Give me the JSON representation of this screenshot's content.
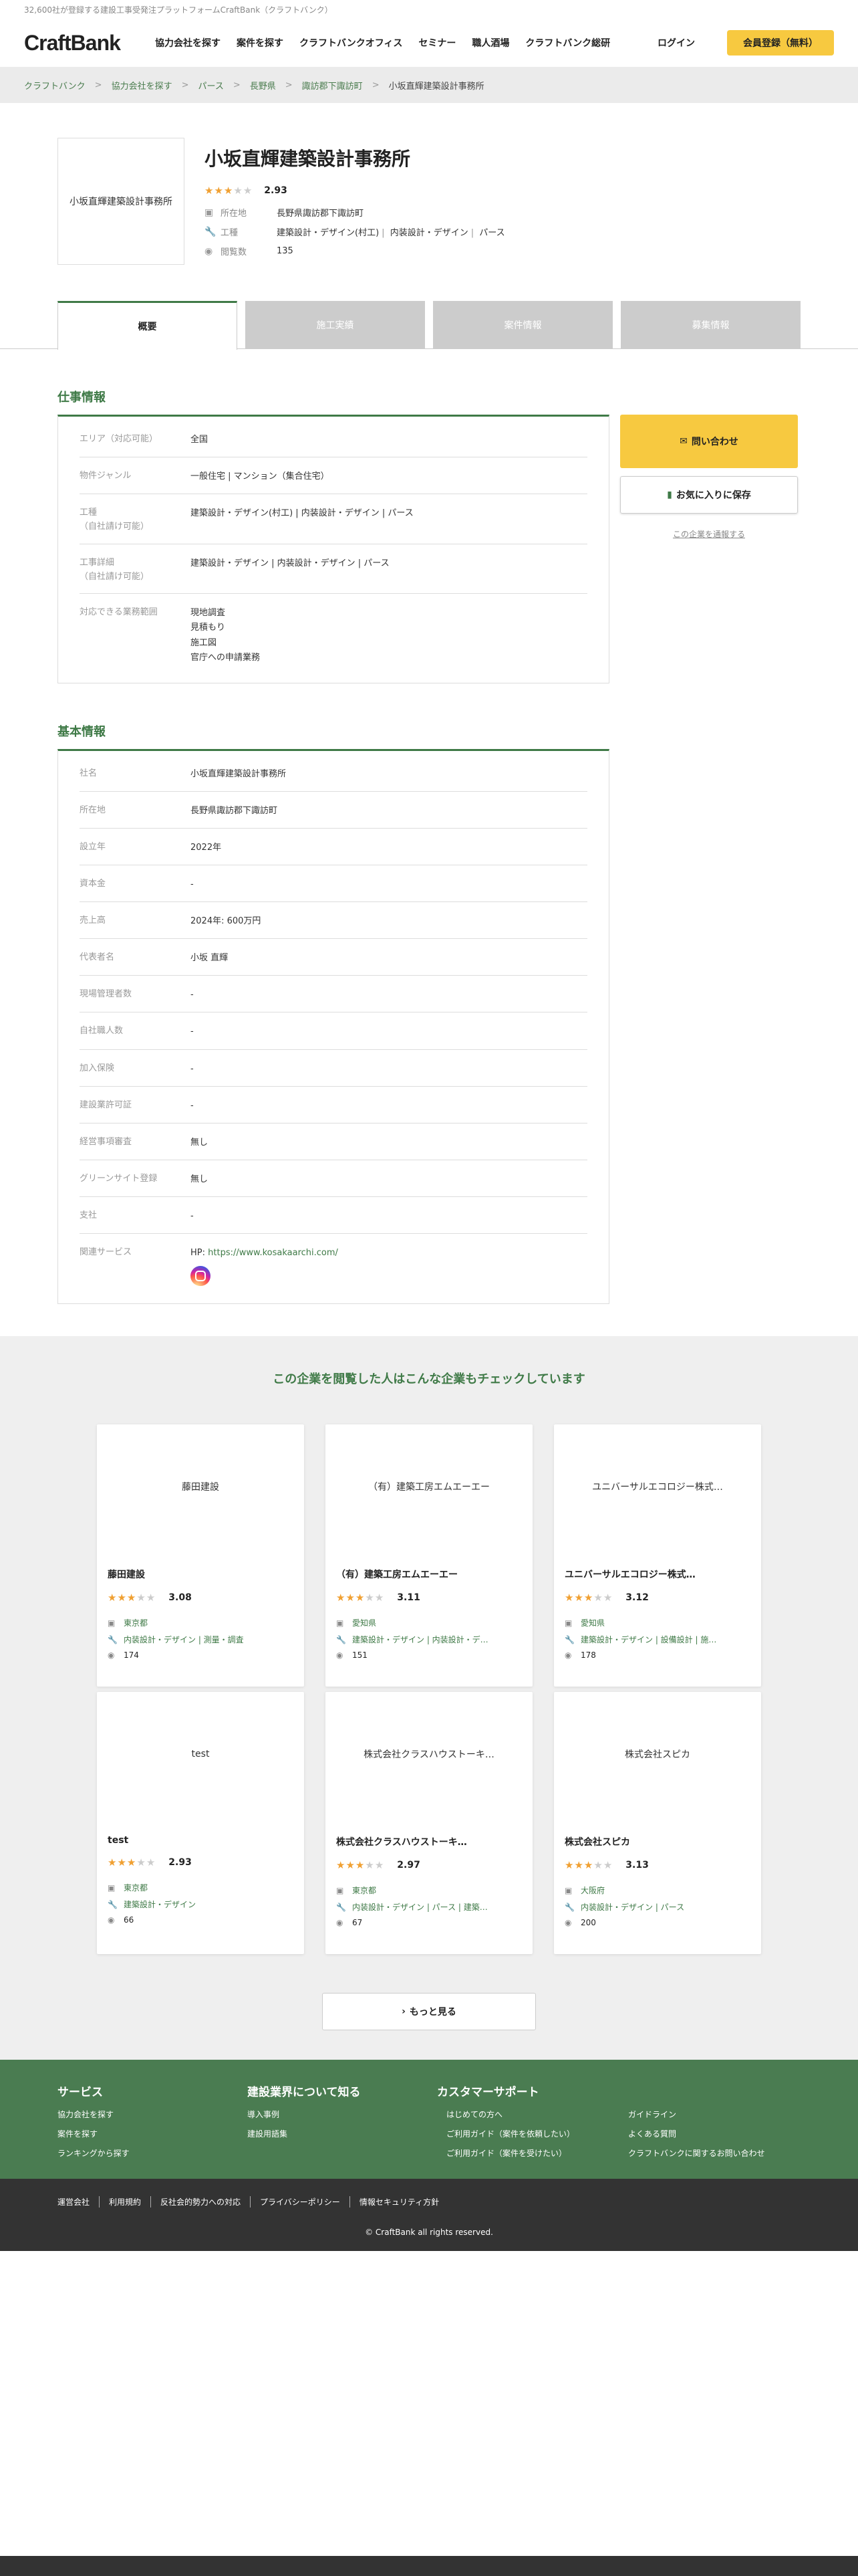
{
  "tagline": "32,600社が登録する建設工事受発注プラットフォームCraftBank（クラフトバンク）",
  "header": {
    "logo": "CraftBank",
    "nav": [
      "協力会社を探す",
      "案件を探す",
      "クラフトバンクオフィス",
      "セミナー",
      "職人酒場",
      "クラフトバンク総研"
    ],
    "login": "ログイン",
    "register": "会員登録（無料）"
  },
  "breadcrumb": [
    "クラフトバンク",
    "協力会社を探す",
    "パース",
    "長野県",
    "諏訪郡下諏訪町",
    "小坂直輝建築設計事務所"
  ],
  "company": {
    "logo_text": "小坂直輝建築設計事務所",
    "name": "小坂直輝建築設計事務所",
    "rating": 2.93,
    "rating_text": "2.93",
    "location_label": "所在地",
    "location": "長野県諏訪郡下諏訪町",
    "trade_label": "工種",
    "trades": [
      "建築設計・デザイン(村工)",
      "内装設計・デザイン",
      "パース"
    ],
    "views_label": "閲覧数",
    "views": "135"
  },
  "tabs": [
    "概要",
    "施工実績",
    "案件情報",
    "募集情報"
  ],
  "job_section": {
    "title": "仕事情報",
    "rows": [
      {
        "k": "エリア（対応可能）",
        "v": [
          "全国"
        ]
      },
      {
        "k": "物件ジャンル",
        "v": [
          "一般住宅 | マンション（集合住宅）"
        ]
      },
      {
        "k": "工種\n（自社請け可能）",
        "v": [
          "建築設計・デザイン(村工) | 内装設計・デザイン | パース"
        ]
      },
      {
        "k": "工事詳細\n（自社請け可能）",
        "v": [
          "建築設計・デザイン | 内装設計・デザイン | パース"
        ]
      },
      {
        "k": "対応できる業務範囲",
        "v": [
          "現地調査",
          "見積もり",
          "施工図",
          "官庁への申請業務"
        ]
      }
    ]
  },
  "side": {
    "contact": "問い合わせ",
    "favorite": "お気に入りに保存",
    "report": "この企業を通報する"
  },
  "basic_section": {
    "title": "基本情報",
    "rows": [
      {
        "k": "社名",
        "v": "小坂直輝建築設計事務所"
      },
      {
        "k": "所在地",
        "v": "長野県諏訪郡下諏訪町"
      },
      {
        "k": "設立年",
        "v": "2022年"
      },
      {
        "k": "資本金",
        "v": "-"
      },
      {
        "k": "売上高",
        "v": "2024年: 600万円"
      },
      {
        "k": "代表者名",
        "v": "小坂 直輝"
      },
      {
        "k": "現場管理者数",
        "v": "-"
      },
      {
        "k": "自社職人数",
        "v": "-"
      },
      {
        "k": "加入保険",
        "v": "-"
      },
      {
        "k": "建設業許可証",
        "v": "-"
      },
      {
        "k": "経営事項審査",
        "v": "無し"
      },
      {
        "k": "グリーンサイト登録",
        "v": "無し"
      },
      {
        "k": "支社",
        "v": "-"
      }
    ],
    "related_label": "関連サービス",
    "hp_prefix": "HP: ",
    "hp_url": "https://www.kosakaarchi.com/"
  },
  "reco": {
    "title": "この企業を閲覧した人はこんな企業もチェックしています",
    "cards": [
      {
        "img": "藤田建設",
        "name": "藤田建設",
        "rating": 3.08,
        "rating_text": "3.08",
        "loc": "東京都",
        "trades": "内装設計・デザイン | 測量・調査",
        "views": "174"
      },
      {
        "img": "（有）建築工房エムエーエー",
        "name": "（有）建築工房エムエーエー",
        "rating": 3.11,
        "rating_text": "3.11",
        "loc": "愛知県",
        "trades": "建築設計・デザイン | 内装設計・デ…",
        "views": "151"
      },
      {
        "img": "ユニバーサルエコロジー株式…",
        "name": "ユニバーサルエコロジー株式…",
        "rating": 3.12,
        "rating_text": "3.12",
        "loc": "愛知県",
        "trades": "建築設計・デザイン | 設備設計 | 施…",
        "views": "178"
      },
      {
        "img": "test",
        "name": "test",
        "rating": 2.93,
        "rating_text": "2.93",
        "loc": "東京都",
        "trades": "建築設計・デザイン",
        "views": "66"
      },
      {
        "img": "株式会社クラスハウストーキ…",
        "name": "株式会社クラスハウストーキ…",
        "rating": 2.97,
        "rating_text": "2.97",
        "loc": "東京都",
        "trades": "内装設計・デザイン | パース | 建築…",
        "views": "67"
      },
      {
        "img": "株式会社スピカ",
        "name": "株式会社スピカ",
        "rating": 3.13,
        "rating_text": "3.13",
        "loc": "大阪府",
        "trades": "内装設計・デザイン | パース",
        "views": "200"
      }
    ],
    "more": "もっと見る"
  },
  "footer": {
    "service_title": "サービス",
    "service": [
      "協力会社を探す",
      "案件を探す",
      "ランキングから探す"
    ],
    "know_title": "建設業界について知る",
    "know": [
      "導入事例",
      "建設用語集"
    ],
    "support_title": "カスタマーサポート",
    "support_a": [
      "はじめての方へ",
      "ご利用ガイド（案件を依頼したい）",
      "ご利用ガイド（案件を受けたい）"
    ],
    "support_b": [
      "ガイドライン",
      "よくある質問",
      "クラフトバンクに関するお問い合わせ"
    ],
    "bottom_links": [
      "運営会社",
      "利用規約",
      "反社会的勢力への対応",
      "プライバシーポリシー",
      "情報セキュリティ方針"
    ],
    "copyright": "© CraftBank all rights reserved."
  }
}
